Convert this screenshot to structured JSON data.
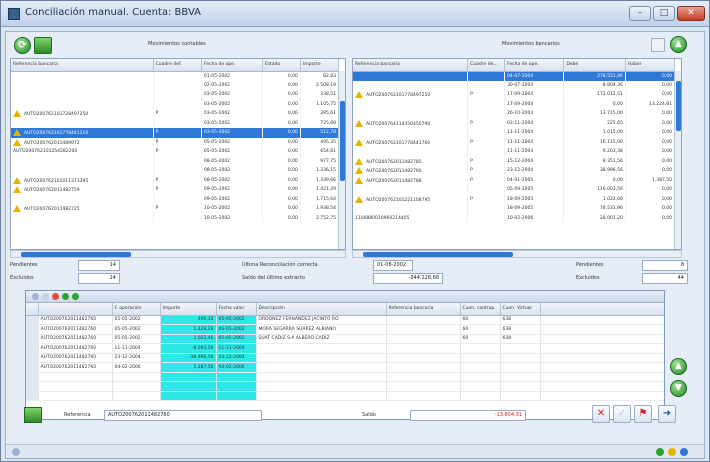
{
  "window": {
    "title": "Conciliación manual. Cuenta: BBVA"
  },
  "left": {
    "header": "Movimientos contables",
    "columns": [
      "Referencia bancaria",
      "Cuadre def.",
      "Fecha de ope.",
      "Estado",
      "Importe"
    ],
    "rows": [
      {
        "ref": "",
        "cuadre": "",
        "fecha": "01-05-2002",
        "estado": "0,00",
        "importe": "82,83",
        "warn": false,
        "sel": false
      },
      {
        "ref": "",
        "cuadre": "",
        "fecha": "02-05-2002",
        "estado": "0,00",
        "importe": "2.508,19",
        "warn": false,
        "sel": false
      },
      {
        "ref": "",
        "cuadre": "",
        "fecha": "03-05-2002",
        "estado": "0,00",
        "importe": "338,51",
        "warn": false,
        "sel": false
      },
      {
        "ref": "",
        "cuadre": "",
        "fecha": "03-05-2002",
        "estado": "0,00",
        "importe": "1.105,75",
        "warn": false,
        "sel": false
      },
      {
        "ref": "AUTO200762101728497250",
        "cuadre": "P",
        "fecha": "03-05-2002",
        "estado": "0,00",
        "importe": "395,61",
        "warn": true,
        "sel": false
      },
      {
        "ref": "",
        "cuadre": "",
        "fecha": "03-05-2002",
        "estado": "0,00",
        "importe": "725,69",
        "warn": false,
        "sel": false
      },
      {
        "ref": "AUTO200762101778441210",
        "cuadre": "P",
        "fecha": "03-05-2002",
        "estado": "0,00",
        "importe": "512,78",
        "warn": true,
        "sel": true
      },
      {
        "ref": "AUTO200762011489972",
        "cuadre": "P",
        "fecha": "05-05-2002",
        "estado": "0,00",
        "importe": "495,35",
        "warn": true,
        "sel": false
      },
      {
        "ref": "AUTO200762101254282200",
        "cuadre": "P",
        "fecha": "05-05-2002",
        "estado": "0,00",
        "importe": "654,81",
        "warn": false,
        "sel": false
      },
      {
        "ref": "",
        "cuadre": "",
        "fecha": "08-05-2002",
        "estado": "0,00",
        "importe": "977,75",
        "warn": false,
        "sel": false
      },
      {
        "ref": "",
        "cuadre": "",
        "fecha": "08-05-2002",
        "estado": "0,00",
        "importe": "1.336,15",
        "warn": false,
        "sel": false
      },
      {
        "ref": "AUTO200762101011373395",
        "cuadre": "P",
        "fecha": "08-05-2002",
        "estado": "0,00",
        "importe": "1.339,66",
        "warn": true,
        "sel": false
      },
      {
        "ref": "AUTO200762011482759",
        "cuadre": "P",
        "fecha": "09-05-2002",
        "estado": "0,00",
        "importe": "1.421,29",
        "warn": true,
        "sel": false
      },
      {
        "ref": "",
        "cuadre": "",
        "fecha": "09-05-2002",
        "estado": "0,00",
        "importe": "1.715,64",
        "warn": false,
        "sel": false
      },
      {
        "ref": "AUTO200762011482725",
        "cuadre": "P",
        "fecha": "10-05-2002",
        "estado": "0,00",
        "importe": "1.938,54",
        "warn": true,
        "sel": false
      },
      {
        "ref": "",
        "cuadre": "",
        "fecha": "10-05-2002",
        "estado": "0,00",
        "importe": "2.752,75",
        "warn": false,
        "sel": false
      }
    ]
  },
  "right": {
    "header": "Movimientos bancarios",
    "columns": [
      "Referencia bancaria",
      "Cuadre de...",
      "Fecha de ope.",
      "Debe",
      "Haber"
    ],
    "rows": [
      {
        "ref": "",
        "cuadre": "",
        "fecha": "04-07-2004",
        "debe": "278.551,46",
        "haber": "0,00",
        "warn": false,
        "sel": true
      },
      {
        "ref": "",
        "cuadre": "",
        "fecha": "30-07-2004",
        "debe": "8.804,36",
        "haber": "0,00",
        "warn": false,
        "sel": false
      },
      {
        "ref": "AUTO200762101778497250",
        "cuadre": "P",
        "fecha": "17-09-2004",
        "debe": "172.012,51",
        "haber": "0,00",
        "warn": true,
        "sel": false
      },
      {
        "ref": "",
        "cuadre": "",
        "fecha": "17-09-2004",
        "debe": "0,00",
        "haber": "13.224,81",
        "warn": false,
        "sel": false
      },
      {
        "ref": "",
        "cuadre": "",
        "fecha": "26-10-2004",
        "debe": "13.715,00",
        "haber": "0,00",
        "warn": false,
        "sel": false
      },
      {
        "ref": "AUTO200764114350450790",
        "cuadre": "P",
        "fecha": "03-11-2004",
        "debe": "225,65",
        "haber": "0,00",
        "warn": true,
        "sel": false
      },
      {
        "ref": "",
        "cuadre": "",
        "fecha": "11-11-2004",
        "debe": "1.015,00",
        "haber": "0,00",
        "warn": false,
        "sel": false
      },
      {
        "ref": "AUTO200762101778441760",
        "cuadre": "P",
        "fecha": "11-11-2004",
        "debe": "16.115,00",
        "haber": "0,00",
        "warn": true,
        "sel": false
      },
      {
        "ref": "",
        "cuadre": "",
        "fecha": "11-11-2004",
        "debe": "9.203,38",
        "haber": "0,00",
        "warn": false,
        "sel": false
      },
      {
        "ref": "AUTO200762011482785",
        "cuadre": "P",
        "fecha": "15-12-2004",
        "debe": "8.351,56",
        "haber": "0,00",
        "warn": true,
        "sel": false
      },
      {
        "ref": "AUTO200762011482760",
        "cuadre": "P",
        "fecha": "23-12-2004",
        "debe": "38.996,56",
        "haber": "0,00",
        "warn": true,
        "sel": false
      },
      {
        "ref": "AUTO200762011482788",
        "cuadre": "P",
        "fecha": "04-01-2005",
        "debe": "0,00",
        "haber": "1.387,50",
        "warn": true,
        "sel": false
      },
      {
        "ref": "",
        "cuadre": "",
        "fecha": "05-09-2005",
        "debe": "116.003,56",
        "haber": "0,00",
        "warn": false,
        "sel": false
      },
      {
        "ref": "AUTO200762101221108795",
        "cuadre": "P",
        "fecha": "18-09-2005",
        "debe": "1.022,66",
        "haber": "0,00",
        "warn": true,
        "sel": false
      },
      {
        "ref": "",
        "cuadre": "",
        "fecha": "18-09-2005",
        "debe": "78.531,96",
        "haber": "0,00",
        "warn": false,
        "sel": false
      },
      {
        "ref": "1100880010960214405",
        "cuadre": "",
        "fecha": "10-02-2006",
        "debe": "28.001,20",
        "haber": "0,00",
        "warn": false,
        "sel": false
      }
    ]
  },
  "summary": {
    "pend_left_label": "Pendientes",
    "pend_left_value": "14",
    "pend_right_label": "Pendientes",
    "pend_right_value": "8",
    "excl_left_label": "Excluidos",
    "excl_left_value": "24",
    "excl_right_label": "Excluidos",
    "excl_right_value": "44",
    "ultima_label": "Última Reconciliación correcta",
    "ultima_value": "01-08-2002",
    "saldo_label": "Saldo del último extracto",
    "saldo_value": "-344.228,68"
  },
  "match": {
    "columns": [
      "",
      "",
      "F. operación",
      "Importe",
      "Fecha valor",
      "Descripción",
      "Referencia bancaria",
      "Cuen. contrap.",
      "Cuen. Virtual"
    ],
    "rows": [
      {
        "ref": "AUTO200762011482760",
        "fop": "05-05-2002",
        "imp": "495,35",
        "fval": "05-05-2002",
        "desc": "ORDONEZ FERNANDEZ JACINTO RO",
        "refb": "",
        "c1": "60",
        "c2": "638"
      },
      {
        "ref": "AUTO200762011482760",
        "fop": "05-05-2002",
        "imp": "1.428,28",
        "fval": "06-05-2002",
        "desc": "MORA SEGARRA SUAREZ ALBIANO",
        "refb": "",
        "c1": "60",
        "c2": "638"
      },
      {
        "ref": "AUTO200762011482760",
        "fop": "05-05-2002",
        "imp": "1.022,46",
        "fval": "05-05-2002",
        "desc": "SUAT CADIZ S.A ALBERO CADIZ",
        "refb": "",
        "c1": "60",
        "c2": "638"
      },
      {
        "ref": "AUTO200762011482760",
        "fop": "11-11-2004",
        "imp": "-8.003,56",
        "fval": "11-11-2004",
        "desc": "",
        "refb": "",
        "c1": "",
        "c2": ""
      },
      {
        "ref": "AUTO200762011482760",
        "fop": "23-12-2004",
        "imp": "-38.996,56",
        "fval": "23-12-2004",
        "desc": "",
        "refb": "",
        "c1": "",
        "c2": ""
      },
      {
        "ref": "AUTO200762011482760",
        "fop": "04-02-2006",
        "imp": "1.287,50",
        "fval": "04-02-2006",
        "desc": "",
        "refb": "",
        "c1": "",
        "c2": ""
      }
    ]
  },
  "footer": {
    "referencia_label": "Referencia",
    "referencia_value": "AUTO200762011482760",
    "saldo_label": "Saldo",
    "saldo_value": "-13.804,31"
  },
  "colors": {
    "accent": "#2f78d8",
    "match_cells": "#2ee8e8",
    "negative": "#d42020"
  }
}
